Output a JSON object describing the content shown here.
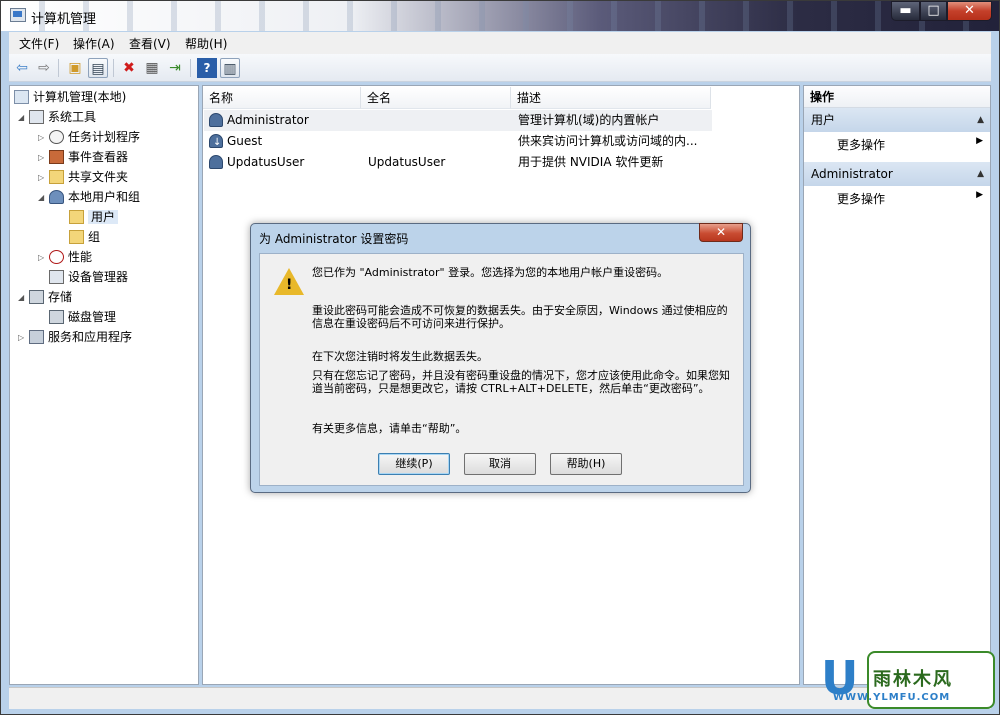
{
  "window": {
    "title": "计算机管理"
  },
  "caption_buttons": {
    "minimize": "▬",
    "maximize": "□",
    "close": "✕"
  },
  "menu": [
    "文件(F)",
    "操作(A)",
    "查看(V)",
    "帮助(H)"
  ],
  "tree": [
    {
      "label": "计算机管理(本地)",
      "expander": "",
      "icon": "computer-icon"
    },
    {
      "label": "系统工具",
      "expander": "◢",
      "icon": "tools-icon"
    },
    {
      "label": "任务计划程序",
      "expander": "▷",
      "icon": "clock-icon"
    },
    {
      "label": "事件查看器",
      "expander": "▷",
      "icon": "event-viewer-icon"
    },
    {
      "label": "共享文件夹",
      "expander": "▷",
      "icon": "shared-folder-icon"
    },
    {
      "label": "本地用户和组",
      "expander": "◢",
      "icon": "users-icon"
    },
    {
      "label": "用户",
      "expander": "",
      "icon": "folder-icon"
    },
    {
      "label": "组",
      "expander": "",
      "icon": "folder-icon"
    },
    {
      "label": "性能",
      "expander": "▷",
      "icon": "performance-icon"
    },
    {
      "label": "设备管理器",
      "expander": "",
      "icon": "device-manager-icon"
    },
    {
      "label": "存储",
      "expander": "◢",
      "icon": "storage-icon"
    },
    {
      "label": "磁盘管理",
      "expander": "",
      "icon": "disk-icon"
    },
    {
      "label": "服务和应用程序",
      "expander": "▷",
      "icon": "services-icon"
    }
  ],
  "list": {
    "columns": [
      "名称",
      "全名",
      "描述"
    ],
    "rows": [
      {
        "name": "Administrator",
        "fullname": "",
        "desc": "管理计算机(域)的内置帐户"
      },
      {
        "name": "Guest",
        "fullname": "",
        "desc": "供来宾访问计算机或访问域的内..."
      },
      {
        "name": "UpdatusUser",
        "fullname": "UpdatusUser",
        "desc": "用于提供 NVIDIA 软件更新"
      }
    ]
  },
  "actions": {
    "header": "操作",
    "sections": [
      {
        "title": "用户",
        "item": "更多操作"
      },
      {
        "title": "Administrator",
        "item": "更多操作"
      }
    ]
  },
  "dialog": {
    "title": "为 Administrator 设置密码",
    "close": "✕",
    "messages": [
      "您已作为 \"Administrator\" 登录。您选择为您的本地用户帐户重设密码。",
      "重设此密码可能会造成不可恢复的数据丢失。由于安全原因，Windows 通过使相应的信息在重设密码后不可访问来进行保护。",
      "在下次您注销时将发生此数据丢失。",
      "只有在您忘记了密码，并且没有密码重设盘的情况下，您才应该使用此命令。如果您知道当前密码，只是想更改它，请按 CTRL+ALT+DELETE，然后单击“更改密码”。",
      "有关更多信息，请单击“帮助”。"
    ],
    "buttons": {
      "continue": "继续(P)",
      "cancel": "取消",
      "help": "帮助(H)"
    }
  },
  "watermark": {
    "letter": "U",
    "name": "雨林木风",
    "url": "WWW.YLMFU.COM"
  }
}
